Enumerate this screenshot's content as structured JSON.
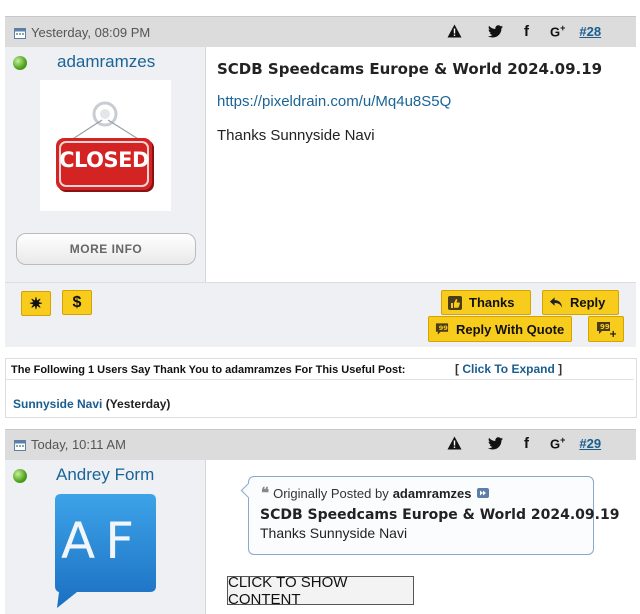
{
  "post28": {
    "date": "Yesterday, 08:09 PM",
    "post_number": "#28",
    "username": "adamramzes",
    "avatar_text": "CLOSED",
    "more_info": "MORE INFO",
    "title": "SCDB Speedcams Europe & World 2024.09.19",
    "link": "https://pixeldrain.com/u/Mq4u8S5Q",
    "body": "Thanks Sunnyside Navi",
    "buttons": {
      "thanks": "Thanks",
      "reply": "Reply",
      "reply_with_quote": "Reply With Quote"
    }
  },
  "thanks_panel": {
    "title": "The Following 1 Users Say Thank You to adamramzes For This Useful Post:",
    "expand_open": "[",
    "expand_label": "Click To Expand",
    "expand_close": "]",
    "user": "Sunnyside Navi",
    "when": "(Yesterday)"
  },
  "post29": {
    "date": "Today, 10:11 AM",
    "post_number": "#29",
    "username": "Andrey Form",
    "avatar_letters": "AF",
    "quote_prefix": "Originally Posted by",
    "quote_author": "adamramzes",
    "quote_title": "SCDB Speedcams Europe & World 2024.09.19",
    "quote_body": "Thanks Sunnyside Navi",
    "show_content": "CLICK TO SHOW CONTENT"
  },
  "colors": {
    "header_bg": "#dcdcdc",
    "accent_yellow": "#f7cc1c",
    "link_blue": "#1a6496"
  },
  "icons": [
    "calendar-icon",
    "warning-icon",
    "twitter-icon",
    "facebook-icon",
    "google-plus-icon",
    "star-icon",
    "dollar-icon",
    "thumbs-up-icon",
    "reply-arrow-icon",
    "quote-icon",
    "multi-quote-icon",
    "quote-marks-icon",
    "view-post-icon",
    "online-status-icon"
  ]
}
